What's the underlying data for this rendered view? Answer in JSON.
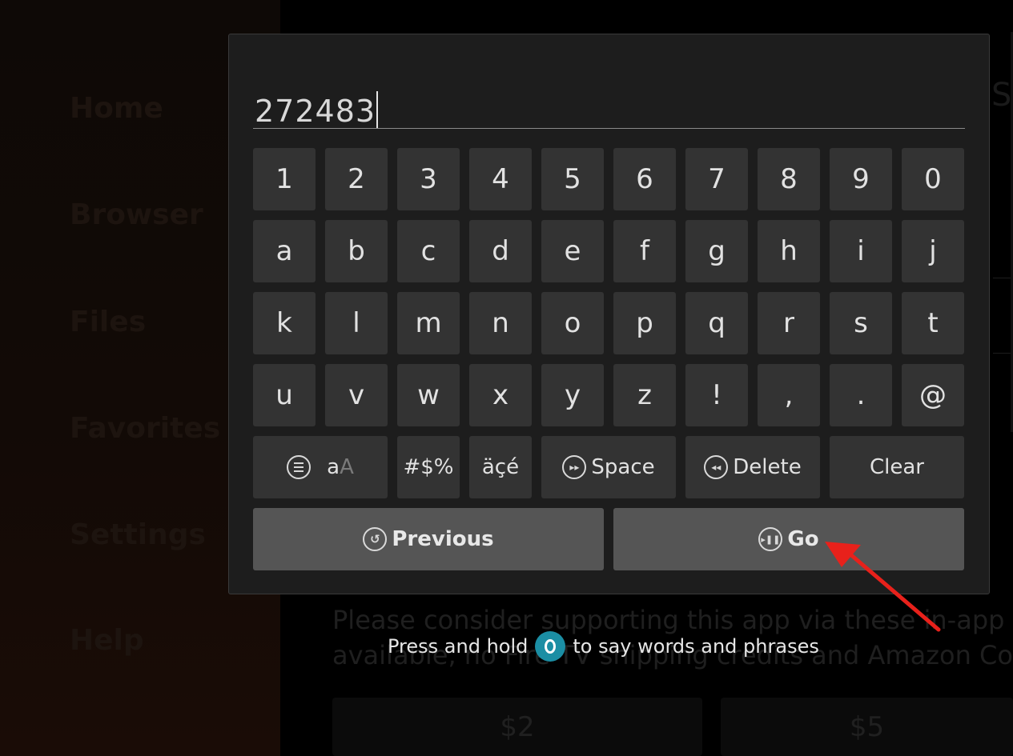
{
  "background": {
    "sidebar_items": [
      "Home",
      "Browser",
      "Files",
      "Favorites",
      "Settings",
      "Help"
    ],
    "support_text": [
      "Please consider supporting this app via these in-app",
      "available, no Fire TV shipping credits and Amazon Coins"
    ],
    "donate_buttons": [
      "$2",
      "$5"
    ],
    "right_glyph": "S"
  },
  "keyboard": {
    "input_value": "272483",
    "rows": [
      [
        "1",
        "2",
        "3",
        "4",
        "5",
        "6",
        "7",
        "8",
        "9",
        "0"
      ],
      [
        "a",
        "b",
        "c",
        "d",
        "e",
        "f",
        "g",
        "h",
        "i",
        "j"
      ],
      [
        "k",
        "l",
        "m",
        "n",
        "o",
        "p",
        "q",
        "r",
        "s",
        "t"
      ],
      [
        "u",
        "v",
        "w",
        "x",
        "y",
        "z",
        "!",
        ",",
        ".",
        "@"
      ]
    ],
    "function_keys": {
      "case_small": "a",
      "case_big": "A",
      "symbols": "#$%",
      "accents": "äçé",
      "space": "Space",
      "delete": "Delete",
      "clear": "Clear"
    },
    "previous_label": "Previous",
    "go_label": "Go"
  },
  "hint": {
    "before": "Press and hold",
    "after": "to say words and phrases"
  },
  "colors": {
    "dialog_bg": "#1d1d1d",
    "key_bg": "#333333",
    "wide_key_bg": "#555555",
    "voice_accent": "#1b8ea4",
    "annotation_arrow": "#e8211b"
  }
}
